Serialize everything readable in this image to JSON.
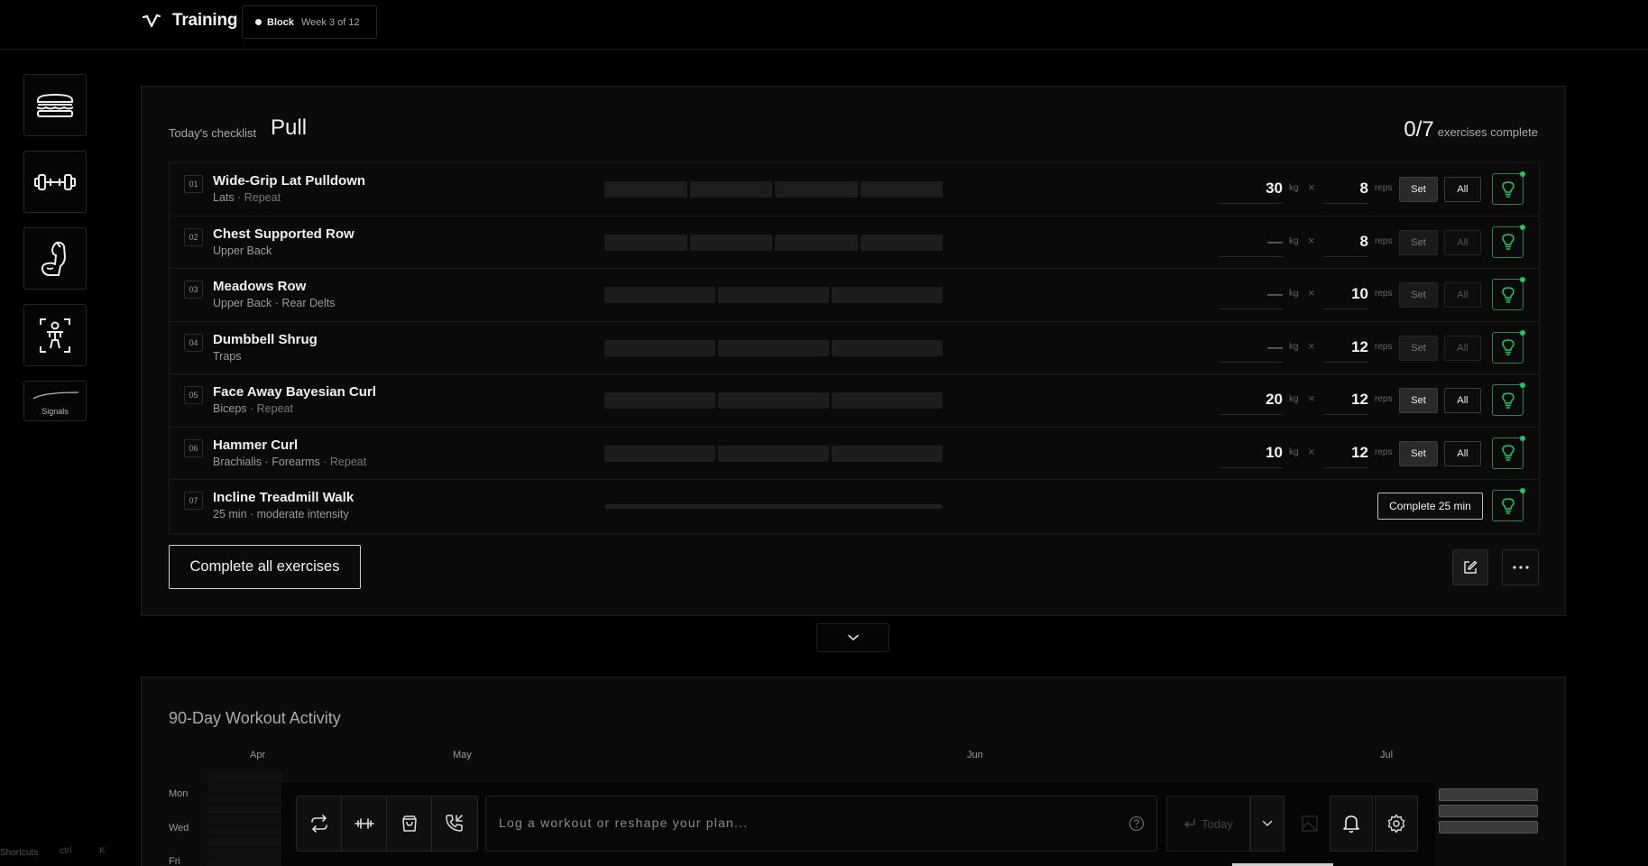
{
  "app": {
    "title": "Training",
    "block_label": "Block",
    "block_week": "Week 3 of 12"
  },
  "sidebar": {
    "items": [
      {
        "icon": "sandwich-icon"
      },
      {
        "icon": "dumbbell-icon"
      },
      {
        "icon": "flexed-arm-icon"
      },
      {
        "icon": "body-scan-icon"
      },
      {
        "icon": "signals-icon",
        "label": "Signals"
      }
    ]
  },
  "checklist": {
    "label": "Today's checklist",
    "workout": "Pull",
    "progress_count": "0/7",
    "progress_label": "exercises complete",
    "unit_kg": "kg",
    "unit_reps": "reps",
    "times": "×",
    "set_label": "Set",
    "all_label": "All",
    "exercises": [
      {
        "num": "01",
        "name": "Wide-Grip Lat Pulldown",
        "muscles": "Lats",
        "repeat": "Repeat",
        "weight": "30",
        "reps": "8",
        "sets": 4,
        "active": true
      },
      {
        "num": "02",
        "name": "Chest Supported Row",
        "muscles": "Upper Back",
        "repeat": "",
        "weight": "—",
        "reps": "8",
        "sets": 4,
        "active": false
      },
      {
        "num": "03",
        "name": "Meadows Row",
        "muscles": "Upper Back · Rear Delts",
        "repeat": "",
        "weight": "—",
        "reps": "10",
        "sets": 3,
        "active": false
      },
      {
        "num": "04",
        "name": "Dumbbell Shrug",
        "muscles": "Traps",
        "repeat": "",
        "weight": "—",
        "reps": "12",
        "sets": 3,
        "active": false
      },
      {
        "num": "05",
        "name": "Face Away Bayesian Curl",
        "muscles": "Biceps",
        "repeat": "Repeat",
        "weight": "20",
        "reps": "12",
        "sets": 3,
        "active": true
      },
      {
        "num": "06",
        "name": "Hammer Curl",
        "muscles": "Brachialis · Forearms",
        "repeat": "Repeat",
        "weight": "10",
        "reps": "12",
        "sets": 3,
        "active": true
      },
      {
        "num": "07",
        "name": "Incline Treadmill Walk",
        "muscles": "25 min · moderate intensity",
        "repeat": "",
        "cardio": true,
        "complete_label": "Complete 25 min"
      }
    ],
    "complete_all_label": "Complete all exercises"
  },
  "activity": {
    "title": "90-Day Workout Activity",
    "months": [
      "Apr",
      "May",
      "Jun",
      "Jul"
    ],
    "days": [
      "Mon",
      "Wed",
      "Fri"
    ]
  },
  "composer": {
    "placeholder": "Log a workout or reshape your plan...",
    "today_label": "Today",
    "tools": [
      "swap-icon",
      "barbell-icon",
      "shopping-bag-icon",
      "phone-call-icon"
    ]
  },
  "footer": {
    "shortcuts_label": "Shortcuts",
    "ctrl": "ctrl",
    "k": "K"
  }
}
